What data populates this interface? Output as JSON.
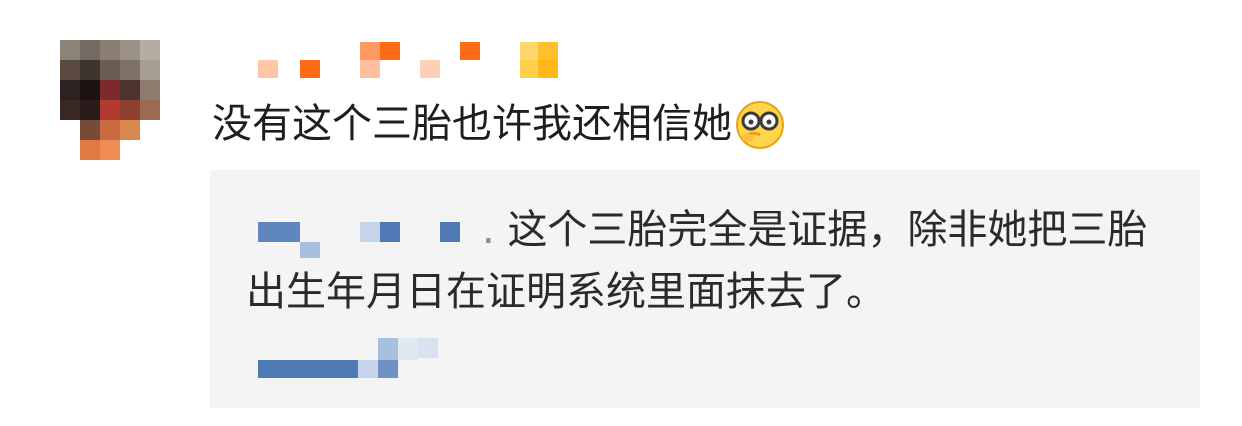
{
  "comment": {
    "text": "没有这个三胎也许我还相信她",
    "emoji": "glasses-face-emoji"
  },
  "reply": {
    "separator": ".",
    "line1": "这个三胎完全是证据，除非她把三胎",
    "line2": "出生年月日在证明系统里面抹去了。"
  },
  "colors": {
    "reply_background": "#f4f4f4",
    "text": "#1e1e1e",
    "username_pixel_orange": "#ff6a14",
    "reply_username_pixel_blue": "#4f7ab5"
  },
  "icons": {
    "avatar": "avatar-icon",
    "emoji": "glasses-face-emoji"
  }
}
